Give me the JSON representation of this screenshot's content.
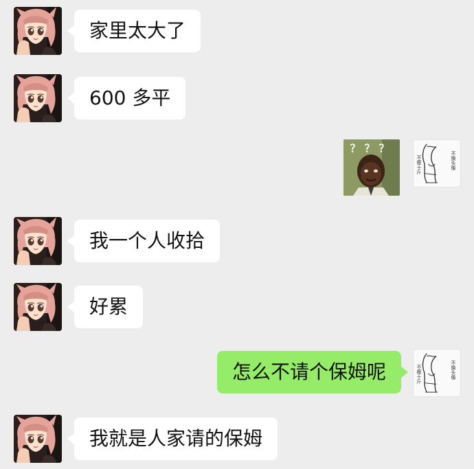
{
  "messages": [
    {
      "side": "in",
      "text": "家里太大了"
    },
    {
      "side": "in",
      "text": "600 多平"
    },
    {
      "side": "out",
      "kind": "sticker",
      "sticker_text": "？？？"
    },
    {
      "side": "in",
      "text": "我一个人收拾"
    },
    {
      "side": "in",
      "text": "好累"
    },
    {
      "side": "out",
      "text": "怎么不请个保姆呢"
    },
    {
      "side": "in",
      "text": "我就是人家请的保姆"
    }
  ],
  "self_avatar": {
    "caption_right": "不换头像",
    "caption_left": "不瘦十斤"
  },
  "colors": {
    "background": "#ededed",
    "incoming_bubble": "#ffffff",
    "outgoing_bubble": "#95ec69"
  },
  "icons": {
    "contact_avatar": "anime-girl-avatar",
    "self_avatar": "sketch-figure-avatar",
    "sticker": "confused-kid-sticker"
  }
}
